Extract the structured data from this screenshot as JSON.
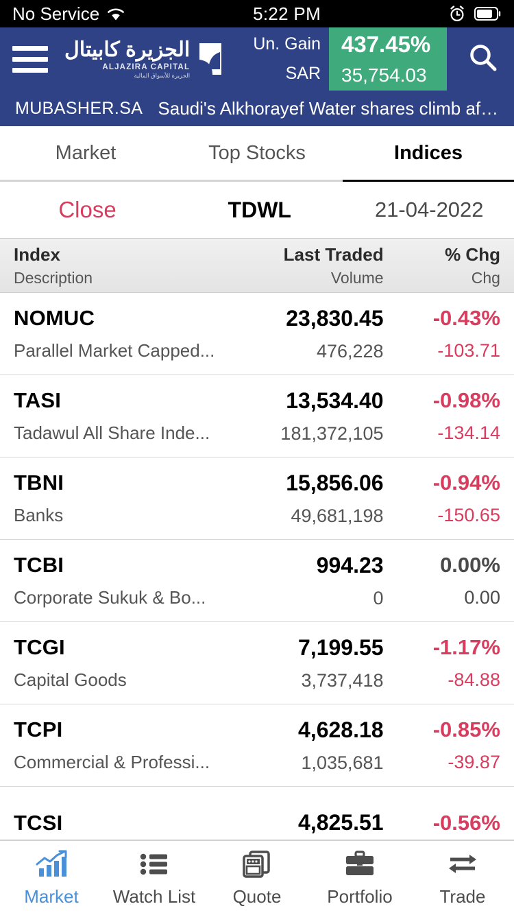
{
  "status_bar": {
    "carrier": "No Service",
    "wifi_icon": "wifi-icon",
    "time": "5:22 PM",
    "alarm_icon": "alarm-clock-icon",
    "battery_icon": "battery-icon"
  },
  "header": {
    "menu_icon": "hamburger-menu-icon",
    "brand_arabic": "الجزيرة كابيتال",
    "brand_english": "ALJAZIRA CAPITAL",
    "brand_arabic_sub": "الجزيرة للأسواق المالية",
    "logo_icon": "aljazira-logo-icon",
    "gain_label": "Un. Gain",
    "gain_percent": "437.45%",
    "currency_label": "SAR",
    "gain_value": "35,754.03",
    "search_icon": "search-icon",
    "bg_color": "#2e4285",
    "gain_bg_color": "#3faa7c"
  },
  "ticker": {
    "source": "MUBASHER.SA",
    "headline": "Saudi's Alkhorayef Water shares climb aft..."
  },
  "tabs": [
    {
      "label": "Market",
      "active": false
    },
    {
      "label": "Top Stocks",
      "active": false
    },
    {
      "label": "Indices",
      "active": true
    }
  ],
  "subbar": {
    "status": "Close",
    "status_color": "#d83c5e",
    "market": "TDWL",
    "date": "21-04-2022"
  },
  "table": {
    "headers": {
      "col1_top": "Index",
      "col1_bottom": "Description",
      "col2_top": "Last Traded",
      "col2_bottom": "Volume",
      "col3_top": "% Chg",
      "col3_bottom": "Chg"
    },
    "rows": [
      {
        "symbol": "NOMUC",
        "description": "Parallel Market Capped...",
        "last_traded": "23,830.45",
        "volume": "476,228",
        "pct_change": "-0.43%",
        "change": "-103.71",
        "direction": "neg"
      },
      {
        "symbol": "TASI",
        "description": "Tadawul All Share Inde...",
        "last_traded": "13,534.40",
        "volume": "181,372,105",
        "pct_change": "-0.98%",
        "change": "-134.14",
        "direction": "neg"
      },
      {
        "symbol": "TBNI",
        "description": "Banks",
        "last_traded": "15,856.06",
        "volume": "49,681,198",
        "pct_change": "-0.94%",
        "change": "-150.65",
        "direction": "neg"
      },
      {
        "symbol": "TCBI",
        "description": "Corporate Sukuk & Bo...",
        "last_traded": "994.23",
        "volume": "0",
        "pct_change": "0.00%",
        "change": "0.00",
        "direction": "flat"
      },
      {
        "symbol": "TCGI",
        "description": "Capital Goods",
        "last_traded": "7,199.55",
        "volume": "3,737,418",
        "pct_change": "-1.17%",
        "change": "-84.88",
        "direction": "neg"
      },
      {
        "symbol": "TCPI",
        "description": "Commercial & Professi...",
        "last_traded": "4,628.18",
        "volume": "1,035,681",
        "pct_change": "-0.85%",
        "change": "-39.87",
        "direction": "neg"
      },
      {
        "symbol": "TCSI",
        "description": "",
        "last_traded": "4,825.51",
        "volume": "",
        "pct_change": "-0.56%",
        "change": "",
        "direction": "neg"
      }
    ]
  },
  "bottom_nav": [
    {
      "label": "Market",
      "icon": "bar-chart-trend-icon",
      "active": true
    },
    {
      "label": "Watch List",
      "icon": "list-icon",
      "active": false
    },
    {
      "label": "Quote",
      "icon": "cards-stack-icon",
      "active": false
    },
    {
      "label": "Portfolio",
      "icon": "briefcase-icon",
      "active": false
    },
    {
      "label": "Trade",
      "icon": "exchange-arrows-icon",
      "active": false
    }
  ],
  "colors": {
    "negative": "#d83c5e",
    "neutral": "#4a4a4a",
    "accent_blue": "#4a90d9",
    "header_navy": "#2e4285",
    "gain_green": "#3faa7c"
  }
}
